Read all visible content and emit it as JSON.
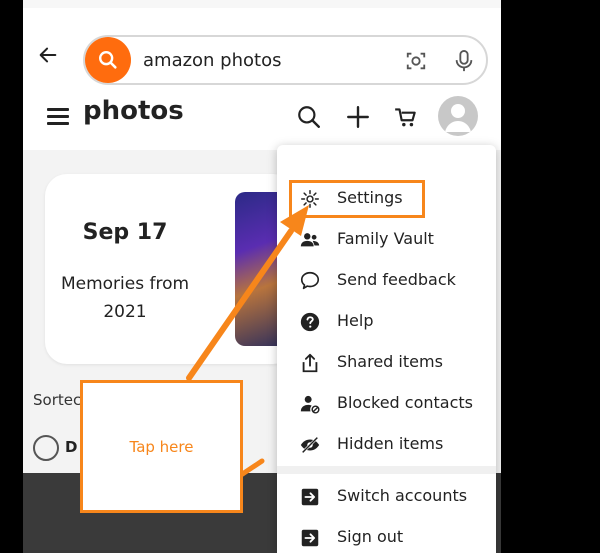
{
  "search": {
    "value": "amazon photos"
  },
  "header": {
    "title": "photos"
  },
  "card": {
    "date": "Sep 17",
    "subtitle_line1": "Memories from",
    "subtitle_line2": "2021"
  },
  "content": {
    "sorted_label": "Sortec",
    "group_label": "D"
  },
  "menu": {
    "items": [
      {
        "label": "Settings",
        "icon": "gear-icon"
      },
      {
        "label": "Family Vault",
        "icon": "people-icon"
      },
      {
        "label": "Send feedback",
        "icon": "speech-bubble-icon"
      },
      {
        "label": "Help",
        "icon": "help-icon"
      },
      {
        "label": "Shared items",
        "icon": "share-icon"
      },
      {
        "label": "Blocked contacts",
        "icon": "blocked-user-icon"
      },
      {
        "label": "Hidden items",
        "icon": "hidden-eye-icon"
      },
      {
        "label": "Switch accounts",
        "icon": "switch-icon"
      },
      {
        "label": "Sign out",
        "icon": "sign-out-icon"
      }
    ]
  },
  "annotation": {
    "callout_text": "Tap here",
    "color": "#f7861b"
  },
  "colors": {
    "accent": "#ff6c0e"
  }
}
